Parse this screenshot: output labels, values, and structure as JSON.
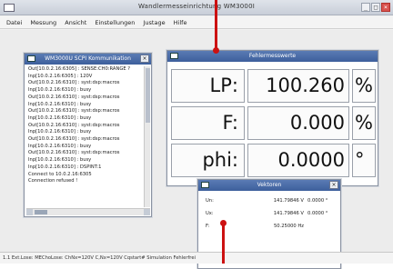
{
  "window": {
    "title": "Wandlermesseinrichtung WM3000I"
  },
  "window_controls": [
    "_",
    "□",
    "×"
  ],
  "menu": [
    "Datei",
    "Messung",
    "Ansicht",
    "Einstellungen",
    "Justage",
    "Hilfe"
  ],
  "scpi": {
    "title": "WM3000U SCPI Kommunikation",
    "lines": [
      "Out[10.0.2.16:6305] : SENSE:CH0:RANGE ?",
      "Inp[10.0.2.16:6305] : 120V",
      "Out[10.0.2.16:6310] : syst:dsp:macros",
      "Inp[10.0.2.16:6310] : busy",
      "Out[10.0.2.16:6310] : syst:dsp:macros",
      "Inp[10.0.2.16:6310] : busy",
      "Out[10.0.2.16:6310] : syst:dsp:macros",
      "Inp[10.0.2.16:6310] : busy",
      "Out[10.0.2.16:6310] : syst:dsp:macros",
      "Inp[10.0.2.16:6310] : busy",
      "Out[10.0.2.16:6310] : syst:dsp:macros",
      "Inp[10.0.2.16:6310] : busy",
      "Out[10.0.2.16:6310] : syst:dsp:macros",
      "Inp[10.0.2.16:6310] : busy",
      "Inp[10.0.2.16:6310] : DSPINT:1",
      "Connect to 10.0.2.16:6305",
      "Connection refused !"
    ]
  },
  "fehler": {
    "title": "Fehlermesswerte",
    "rows": [
      {
        "label": "LP:",
        "value": "100.260",
        "unit": "%"
      },
      {
        "label": "F:",
        "value": "0.000",
        "unit": "%"
      },
      {
        "label": "phi:",
        "value": "0.0000",
        "unit": "°"
      }
    ]
  },
  "vektoren": {
    "title": "Vektoren",
    "rows": [
      {
        "name": "Un:",
        "value": "141.79846 V",
        "phase": "0.0000 °"
      },
      {
        "name": "Ux:",
        "value": "141.79846 V",
        "phase": "0.0000 °"
      },
      {
        "name": "F:",
        "value": "50.25000 Hz",
        "phase": ""
      }
    ]
  },
  "status": {
    "text": "1.1 Ext.Lose: MEChoLose: ChNx=120V C,Nx=120V Cqstart# Simulation Fehlerfrei"
  },
  "colors": {
    "accent": "#3d5f9c",
    "marker": "#cc1111"
  }
}
